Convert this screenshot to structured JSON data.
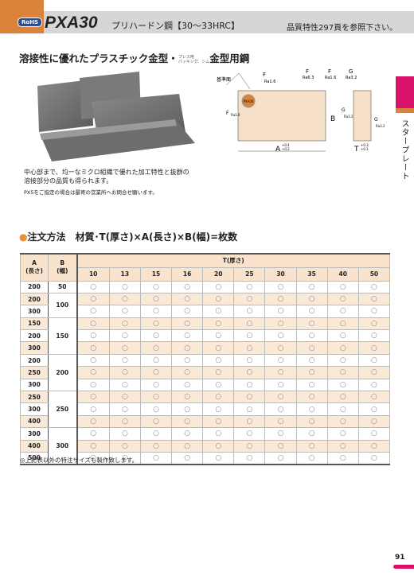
{
  "header": {
    "badge": "RoHS",
    "title": "PXA30",
    "subtitle": "プリハードン鋼【30〜33HRC】",
    "reference": "品質特性297頁を参照下さい。"
  },
  "lead": {
    "main": "溶接性に優れたプラスチック金型・",
    "small1": "プレス用",
    "small2": "パッキング、シム",
    "tail": "金型用鋼"
  },
  "diagram": {
    "datum": "基準面",
    "f": "F",
    "g": "G",
    "ra16": "Ra1.6",
    "ra63": "Ra6.3",
    "ra32": "Ra3.2",
    "a": "A",
    "b": "B",
    "t": "T",
    "tolA1": "+0.4",
    "tolA2": "+0.2",
    "tolT1": "+0.3",
    "tolT2": "+0.1",
    "stamp": "PXA30"
  },
  "sidebar": {
    "label": "スタープレート",
    "accent": "#d9116b",
    "accent2": "#d9843a"
  },
  "description": {
    "line1": "中心部まで、均一なミクロ組織で優れた加工特性と抜群の",
    "line2": "溶接部分の品質も得られます。",
    "note": "PX5をご指定の場合は最寄の営業所へお問合せ願います。"
  },
  "order": {
    "bullet": "●",
    "text": "注文方法　材質･T(厚さ)×A(長さ)×B(幅)=枚数"
  },
  "table": {
    "header_a": "A",
    "header_a2": "(長さ)",
    "header_b": "B",
    "header_b2": "(幅)",
    "header_t": "T(厚さ)",
    "t_values": [
      "10",
      "13",
      "15",
      "16",
      "20",
      "25",
      "30",
      "35",
      "40",
      "50"
    ],
    "mark": "○",
    "groups": [
      {
        "b": "50",
        "a": [
          "200"
        ]
      },
      {
        "b": "100",
        "a": [
          "200",
          "300"
        ]
      },
      {
        "b": "150",
        "a": [
          "150",
          "200",
          "300"
        ]
      },
      {
        "b": "200",
        "a": [
          "200",
          "250",
          "300"
        ]
      },
      {
        "b": "250",
        "a": [
          "250",
          "300",
          "400"
        ]
      },
      {
        "b": "300",
        "a": [
          "300",
          "400",
          "500"
        ]
      }
    ]
  },
  "footnote": "◎上記表以外の特注サイズも製作致します。",
  "page_number": "91"
}
